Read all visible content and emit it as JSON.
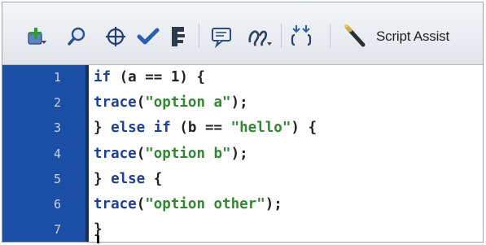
{
  "toolbar": {
    "tools": [
      {
        "name": "add-statement-icon"
      },
      {
        "name": "find-icon"
      },
      {
        "name": "target-icon"
      },
      {
        "name": "check-syntax-icon"
      },
      {
        "name": "auto-format-icon"
      },
      {
        "name": "code-hint-icon"
      },
      {
        "name": "debug-options-icon"
      },
      {
        "name": "collapse-icon"
      }
    ],
    "script_assist_label": "Script Assist"
  },
  "editor": {
    "lines": [
      {
        "num": "1",
        "tokens": [
          {
            "t": "if",
            "c": "kw"
          },
          {
            "t": " (a == 1) {",
            "c": "op"
          }
        ]
      },
      {
        "num": "2",
        "tokens": [
          {
            "t": "trace",
            "c": "kw"
          },
          {
            "t": "(",
            "c": "op"
          },
          {
            "t": "\"option a\"",
            "c": "str"
          },
          {
            "t": ");",
            "c": "op"
          }
        ]
      },
      {
        "num": "3",
        "tokens": [
          {
            "t": "} ",
            "c": "op"
          },
          {
            "t": "else if",
            "c": "kw"
          },
          {
            "t": " (b == ",
            "c": "op"
          },
          {
            "t": "\"hello\"",
            "c": "str"
          },
          {
            "t": ") {",
            "c": "op"
          }
        ]
      },
      {
        "num": "4",
        "tokens": [
          {
            "t": "trace",
            "c": "kw"
          },
          {
            "t": "(",
            "c": "op"
          },
          {
            "t": "\"option b\"",
            "c": "str"
          },
          {
            "t": ");",
            "c": "op"
          }
        ]
      },
      {
        "num": "5",
        "tokens": [
          {
            "t": "} ",
            "c": "op"
          },
          {
            "t": "else",
            "c": "kw"
          },
          {
            "t": " {",
            "c": "op"
          }
        ]
      },
      {
        "num": "6",
        "tokens": [
          {
            "t": "trace",
            "c": "kw"
          },
          {
            "t": "(",
            "c": "op"
          },
          {
            "t": "\"option other\"",
            "c": "str"
          },
          {
            "t": ");",
            "c": "op"
          }
        ]
      },
      {
        "num": "7",
        "tokens": [
          {
            "t": "}",
            "c": "op"
          }
        ]
      }
    ]
  },
  "colors": {
    "gutter": "#1b4fa6",
    "keyword": "#1a3fa0",
    "string": "#2f8a2f"
  }
}
